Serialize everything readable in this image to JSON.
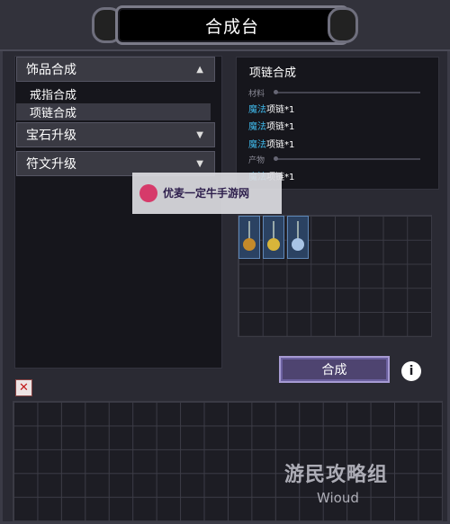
{
  "window": {
    "title": "合成台"
  },
  "categories": [
    {
      "label": "饰品合成",
      "expanded": true,
      "arrow": "▲",
      "items": [
        {
          "label": "戒指合成"
        },
        {
          "label": "项链合成",
          "selected": true
        }
      ]
    },
    {
      "label": "宝石升级",
      "expanded": false,
      "arrow": "▼"
    },
    {
      "label": "符文升级",
      "expanded": false,
      "arrow": "▼"
    }
  ],
  "recipe": {
    "title": "项链合成",
    "materials_label": "材料",
    "materials": [
      {
        "highlight": "魔法",
        "rest": "项链*1"
      },
      {
        "highlight": "魔法",
        "rest": "项链*1"
      },
      {
        "highlight": "魔法",
        "rest": "项链*1"
      }
    ],
    "product_label": "产物",
    "product": {
      "highlight": "魔法",
      "rest": "项链*1"
    }
  },
  "grid_items": [
    {
      "gem_color": "#c48a2a"
    },
    {
      "gem_color": "#d8b53a"
    },
    {
      "gem_color": "#a8c4e6"
    }
  ],
  "actions": {
    "craft_label": "合成",
    "info_label": "i",
    "close_label": "✕"
  },
  "watermarks": {
    "center": "优麦一定牛手游网",
    "brand": "游民攻略组",
    "brand_sub": "Wioud"
  }
}
